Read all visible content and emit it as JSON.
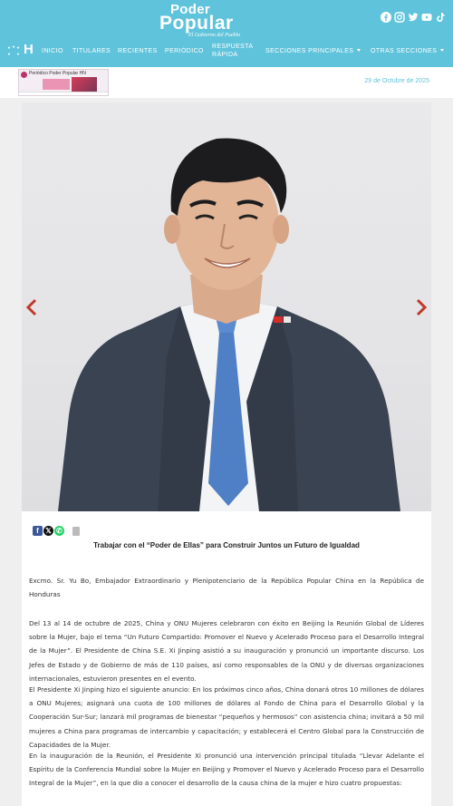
{
  "header": {
    "logo_line1": "Poder",
    "logo_line2": "Popular",
    "logo_tagline": "El Gobierno del Pueblo",
    "social_icons": [
      "facebook-icon",
      "instagram-icon",
      "twitter-icon",
      "youtube-icon",
      "tiktok-icon"
    ],
    "brand_letter": "H",
    "nav": {
      "inicio": "INICIO",
      "titulares": "TITULARES",
      "recientes": "RECIENTES",
      "periodico": "PERIÓDICO",
      "respuesta_1": "RESPUESTA",
      "respuesta_2": "RÁPIDA",
      "secciones": "SECCIONES PRINCIPALES",
      "otras": "OTRAS SECCIONES"
    },
    "bg_color": "#5fc3db"
  },
  "subbar": {
    "banner_text": "Periódico Poder Popular HN",
    "date": "29 de Octubre de 2025"
  },
  "article": {
    "share_icons": [
      "facebook-icon",
      "x-icon",
      "whatsapp-icon",
      "print-icon"
    ],
    "title": "Trabajar con el “Poder de Ellas” para Construir Juntos un Futuro de Igualdad",
    "byline": "Excmo. Sr. Yu Bo, Embajador Extraordinario y Plenipotenciario de la República Popular China en la República de Honduras",
    "p1": "Del 13 al 14 de octubre de 2025, China y ONU Mujeres celebraron con éxito en Beijing la Reunión Global de Líderes sobre la Mujer, bajo el tema “Un Futuro Compartido: Promover el Nuevo y Acelerado Proceso para el Desarrollo Integral de la Mujer”. El Presidente de China S.E. Xi Jinping asistió a su inauguración y pronunció un importante discurso. Los Jefes de Estado y de Gobierno de más de 110 países, así como responsables de la ONU y de diversas organizaciones internacionales, estuvieron presentes en el evento.",
    "p2": "El Presidente Xi Jinping hizo el siguiente anuncio: En los próximos cinco años, China donará otros 10 millones de dólares a ONU Mujeres; asignará una cuota de 100 millones de dólares al Fondo de China para el Desarrollo Global y la Cooperación Sur-Sur; lanzará mil programas de bienestar “pequeños y hermosos” con asistencia china; invitará a 50 mil mujeres a China para programas de intercambio y capacitación; y establecerá el Centro Global para la Construcción de Capacidades de la Mujer.",
    "p3": "En la inauguración de la Reunión, el Presidente Xi pronunció una intervención principal titulada “Llevar Adelante el Espíritu de la Conferencia Mundial sobre la Mujer en Beijing y Promover el Nuevo y Acelerado Proceso para el Desarrollo Integral de la Mujer”, en la que dio a conocer el desarrollo de la causa china de la mujer e hizo cuatro propuestas:"
  }
}
